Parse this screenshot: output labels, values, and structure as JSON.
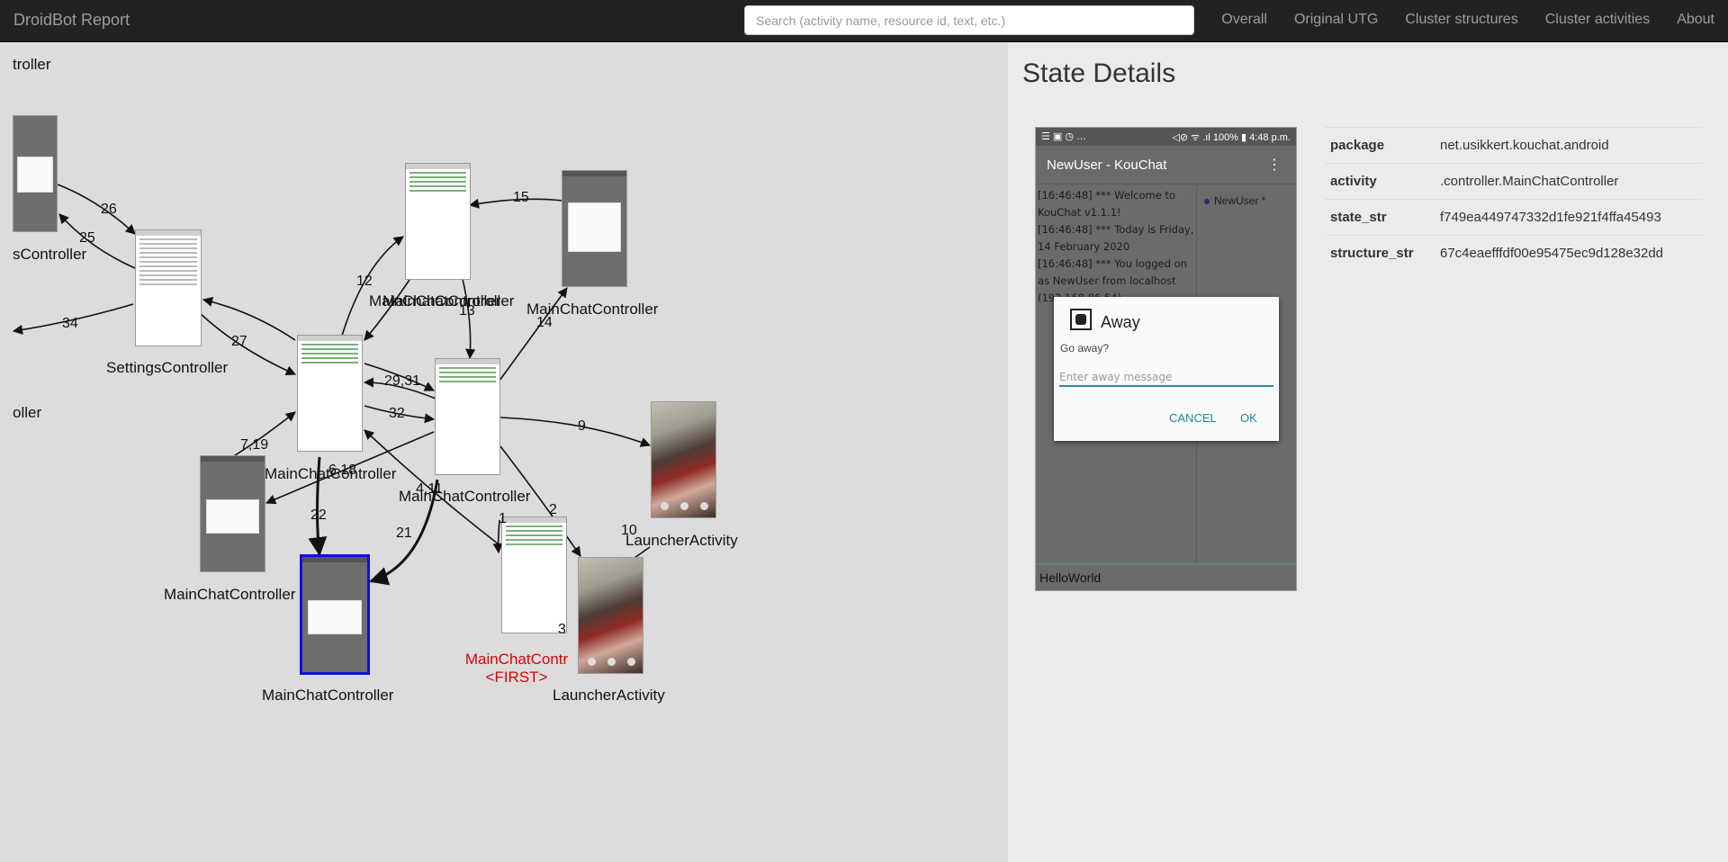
{
  "navbar": {
    "brand": "DroidBot Report",
    "search_placeholder": "Search (activity name, resource id, text, etc.)",
    "links": [
      "Overall",
      "Original UTG",
      "Cluster structures",
      "Cluster activities",
      "About"
    ]
  },
  "graph": {
    "node_labels": {
      "top_left": "troller",
      "settings_left": "sController",
      "left_mid": "oller",
      "settings": "SettingsController",
      "main_top": "MainChatController",
      "main_top_overlap": "MainChatController",
      "main_top_right": "MainChatController",
      "main_left": "MainChatController",
      "main_center": "MainChatController",
      "main_dialog": "MainChatController",
      "main_selected": "MainChatController",
      "launcher_right": "LauncherActivity",
      "launcher_bottom": "LauncherActivity",
      "first_name": "MainChatContr",
      "first_tag": "<FIRST>"
    },
    "edge_labels": [
      "26",
      "25",
      "34",
      "27",
      "12",
      "15",
      "13",
      "14",
      "29,31",
      "32",
      "9",
      "7,19",
      "6,18",
      "4,11",
      "22",
      "21",
      "2",
      "10",
      "1",
      "3"
    ]
  },
  "details": {
    "heading": "State Details",
    "device": {
      "status_left": "☰ ▣ ◷ …",
      "status_right": "◁⊘ ᯤ .ıl 100% ▮ 4:48 p.m.",
      "app_title": "NewUser - KouChat",
      "menu_glyph": "⋮",
      "chat_lines": [
        "[16:46:48] *** Welcome to",
        "KouChat v1.1.1!",
        "[16:46:48] *** Today is Friday,",
        "14 February 2020",
        "[16:46:48] *** You logged on",
        "as NewUser from localhost",
        "(192.168.86.54)"
      ],
      "user": "NewUser *",
      "input_text": "HelloWorld",
      "dialog": {
        "title": "Away",
        "message": "Go away?",
        "placeholder": "Enter away message",
        "cancel": "CANCEL",
        "ok": "OK"
      }
    },
    "properties": [
      {
        "key": "package",
        "value": "net.usikkert.kouchat.android"
      },
      {
        "key": "activity",
        "value": ".controller.MainChatController"
      },
      {
        "key": "state_str",
        "value": "f749ea449747332d1fe921f4ffa45493"
      },
      {
        "key": "structure_str",
        "value": "67c4eaefffdf00e95475ec9d128e32dd"
      }
    ]
  },
  "colors": {
    "navbar": "#222222",
    "first_label": "#e00000",
    "selected_border": "#1010d8",
    "dialog_accent": "#1a8a8a"
  }
}
